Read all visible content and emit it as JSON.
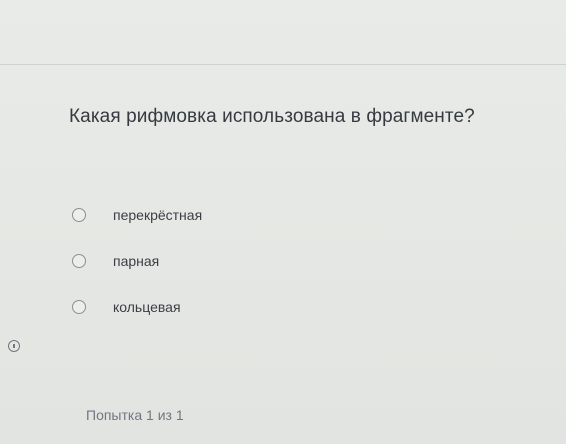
{
  "question": {
    "text": "Какая рифмовка использована в фрагменте?"
  },
  "options": [
    {
      "label": "перекрёстная"
    },
    {
      "label": "парная"
    },
    {
      "label": "кольцевая"
    }
  ],
  "footer": {
    "attempt_text": "Попытка 1 из 1"
  },
  "icons": {
    "info": "info-icon"
  }
}
